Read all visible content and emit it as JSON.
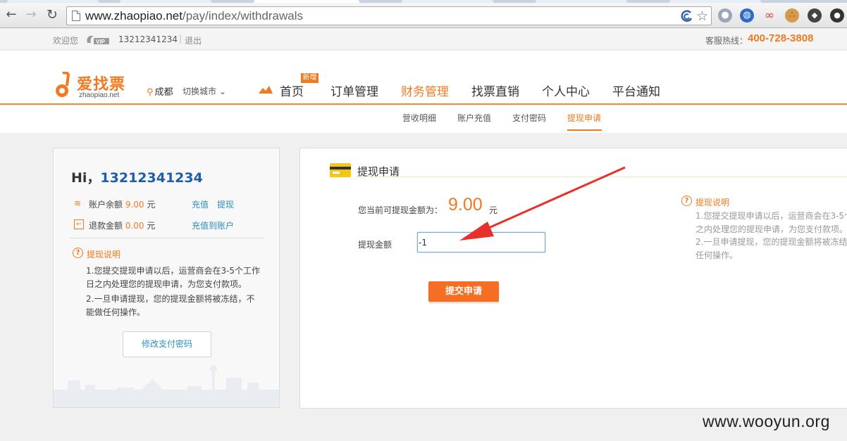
{
  "browser": {
    "url_host": "www.zhaopiao.net",
    "url_path": "/pay/index/withdrawals"
  },
  "topbar": {
    "welcome": "欢迎您",
    "vip_text": "VIP",
    "phone": "13212341234",
    "separator": "|",
    "logout": "退出",
    "hotline_label": "客服热线：",
    "hotline": "400-728-3808"
  },
  "header": {
    "logo_cn": "爱找票",
    "logo_en": "zhaopiao.net",
    "city": "成都",
    "switch_city": "切换城市 ⌄",
    "nav": [
      "首页",
      "订单管理",
      "财务管理",
      "找票直销",
      "个人中心",
      "平台通知"
    ],
    "new_badge": "新增",
    "subnav": [
      "营收明细",
      "账户充值",
      "支付密码",
      "提现申请"
    ]
  },
  "account": {
    "hi": "Hi，",
    "phone": "13212341234",
    "balance_label": "账户余额",
    "balance_value": "9.00",
    "balance_unit": "元",
    "recharge": "充值",
    "withdraw": "提现",
    "refund_label": "退款金额",
    "refund_value": "0.00",
    "refund_unit": "元",
    "refund_to_account": "充值到账户",
    "help_title": "提现说明",
    "help_1a": "1.您提交提现申请以后，运营商会在3-5个工作",
    "help_1b": "日之内处理您的提现申请，为您支付款项。",
    "help_2a": "2.一旦申请提现，您的提现金额将被冻结，不",
    "help_2b": "能做任何操作。",
    "change_pwd": "修改支付密码"
  },
  "withdraw_form": {
    "title": "提现申请",
    "avail_label": "您当前可提现金额为：",
    "avail_amount": "9.00",
    "avail_unit": "元",
    "amount_label": "提现金额",
    "amount_value": "-1",
    "submit": "提交申请",
    "help_title": "提现说明",
    "help_1a": "1.您提交提现申请以后，运营商会在3-5个",
    "help_1b": "之内处理您的提现申请，为您支付款项。",
    "help_2a": "2.一旦申请提现，您的提现金额将被冻结",
    "help_2b": "任何操作。"
  },
  "watermark": "www.wooyun.org",
  "colors": {
    "accent": "#f07a22",
    "link": "#2a8fbf",
    "arrow": "#e8312a"
  }
}
